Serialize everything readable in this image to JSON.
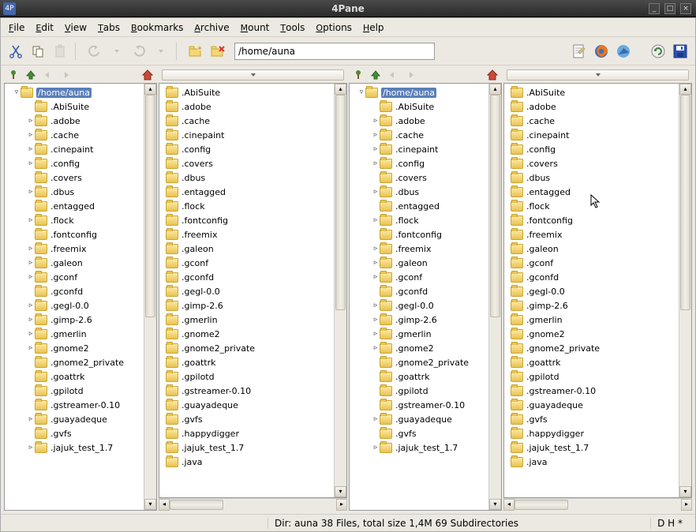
{
  "title": "4Pane",
  "menu": [
    "File",
    "Edit",
    "View",
    "Tabs",
    "Bookmarks",
    "Archive",
    "Mount",
    "Tools",
    "Options",
    "Help"
  ],
  "path": "/home/auna",
  "tree_root": "/home/auna",
  "tree_items": [
    {
      "name": ".AbiSuite",
      "exp": false
    },
    {
      "name": ".adobe",
      "exp": true
    },
    {
      "name": ".cache",
      "exp": true
    },
    {
      "name": ".cinepaint",
      "exp": true
    },
    {
      "name": ".config",
      "exp": true
    },
    {
      "name": ".covers",
      "exp": false
    },
    {
      "name": ".dbus",
      "exp": true
    },
    {
      "name": ".entagged",
      "exp": false
    },
    {
      "name": ".flock",
      "exp": true
    },
    {
      "name": ".fontconfig",
      "exp": false
    },
    {
      "name": ".freemix",
      "exp": true
    },
    {
      "name": ".galeon",
      "exp": true
    },
    {
      "name": ".gconf",
      "exp": true
    },
    {
      "name": ".gconfd",
      "exp": false
    },
    {
      "name": ".gegl-0.0",
      "exp": true
    },
    {
      "name": ".gimp-2.6",
      "exp": true
    },
    {
      "name": ".gmerlin",
      "exp": true
    },
    {
      "name": ".gnome2",
      "exp": true
    },
    {
      "name": ".gnome2_private",
      "exp": false
    },
    {
      "name": ".goattrk",
      "exp": false
    },
    {
      "name": ".gpilotd",
      "exp": false
    },
    {
      "name": ".gstreamer-0.10",
      "exp": false
    },
    {
      "name": ".guayadeque",
      "exp": true
    },
    {
      "name": ".gvfs",
      "exp": false
    },
    {
      "name": ".jajuk_test_1.7",
      "exp": true
    }
  ],
  "list_items": [
    ".AbiSuite",
    ".adobe",
    ".cache",
    ".cinepaint",
    ".config",
    ".covers",
    ".dbus",
    ".entagged",
    ".flock",
    ".fontconfig",
    ".freemix",
    ".galeon",
    ".gconf",
    ".gconfd",
    ".gegl-0.0",
    ".gimp-2.6",
    ".gmerlin",
    ".gnome2",
    ".gnome2_private",
    ".goattrk",
    ".gpilotd",
    ".gstreamer-0.10",
    ".guayadeque",
    ".gvfs",
    ".happydigger",
    ".jajuk_test_1.7",
    ".java"
  ],
  "status_mid": "Dir: auna   38 Files, total size 1,4M   69 Subdirectories",
  "status_right": "D H    *"
}
